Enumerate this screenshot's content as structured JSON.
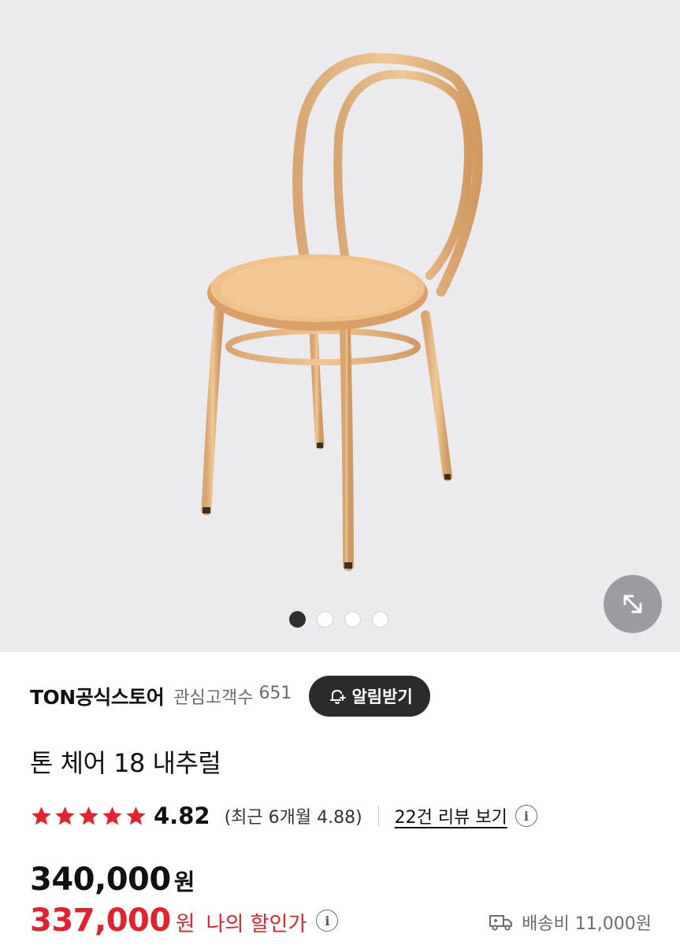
{
  "product_image": {
    "description_icon": "chair-photo",
    "carousel": {
      "total": 4,
      "active_index": 0
    },
    "expand_icon": "expand-arrows-icon"
  },
  "store": {
    "name": "TON공식스토어",
    "followers_label": "관심고객수",
    "followers_count": "651",
    "alarm_button": "알림받기",
    "alarm_icon": "bell-plus-icon"
  },
  "product": {
    "title": "톤 체어 18 내추럴"
  },
  "rating": {
    "stars": 5,
    "score": "4.82",
    "recent": "(최근 6개월 4.88)",
    "reviews_link": "22건 리뷰 보기",
    "info_icon": "info-icon"
  },
  "price": {
    "original": "340,000",
    "original_unit": "원",
    "sale": "337,000",
    "sale_unit": "원",
    "sale_label": "나의 할인가",
    "info_icon": "info-icon"
  },
  "shipping": {
    "icon": "truck-icon",
    "label": "배송비 11,000원"
  },
  "colors": {
    "accent_red": "#e5202f",
    "star_red": "#e5202f",
    "dark_button": "#2b2b2b"
  }
}
